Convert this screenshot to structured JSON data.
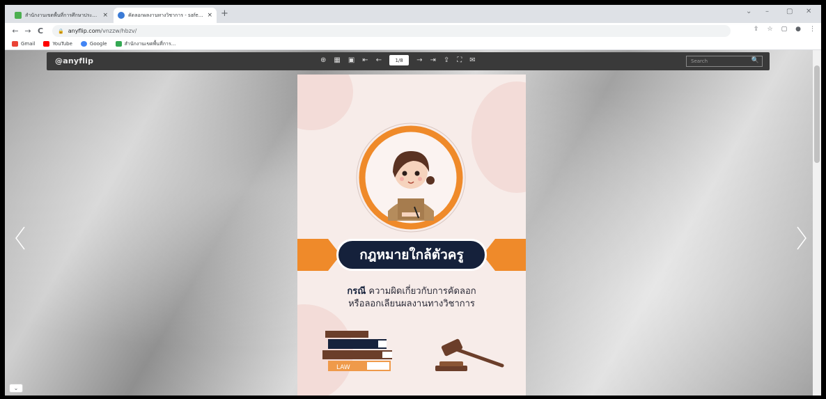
{
  "tabs": [
    {
      "title": "สำนักงานเขตพื้นที่การศึกษาประถมศึกษา",
      "close": "×"
    },
    {
      "title": "คัดลอกผลงานทางวิชาการ - safee.h",
      "close": "×"
    }
  ],
  "new_tab": "+",
  "window_controls": {
    "list": "⌄",
    "minimize": "–",
    "restore": "▢",
    "close": "✕"
  },
  "nav": {
    "back": "←",
    "forward": "→",
    "reload": "C"
  },
  "address": {
    "host": "anyflip.com",
    "path": "/vnzzw/hbzv/"
  },
  "toolbar_icons": {
    "share": "⇪",
    "star": "☆",
    "sidepanel": "▢",
    "profile": "●",
    "menu": "⋮"
  },
  "bookmarks": [
    {
      "label": "Gmail",
      "color": "#ea4335"
    },
    {
      "label": "YouTube",
      "color": "#ff0000"
    },
    {
      "label": "Google",
      "color": "#4285f4"
    },
    {
      "label": "สำนักงานเขตพื้นที่การ...",
      "color": "#34a853"
    }
  ],
  "viewer": {
    "logo": "@anyflip",
    "page_indicator": "1/8",
    "search_placeholder": "Search",
    "search_icon": "🔍"
  },
  "flip_tools": [
    "⊕",
    "▦",
    "▣",
    "⇤",
    "←",
    "→",
    "⇥",
    "⇪",
    "⛶",
    "✉"
  ],
  "page": {
    "banner_title": "กฎหมายใกล้ตัวครู",
    "subtitle_bold": "กรณี",
    "subtitle_line1": " ความผิดเกี่ยวกับการคัดลอก",
    "subtitle_line2": "หรือลอกเลียนผลงานทางวิชาการ",
    "book_label": "LAW"
  },
  "colors": {
    "orange": "#ef8a2a",
    "navy": "#15213b",
    "page_bg": "#f7ece9"
  }
}
